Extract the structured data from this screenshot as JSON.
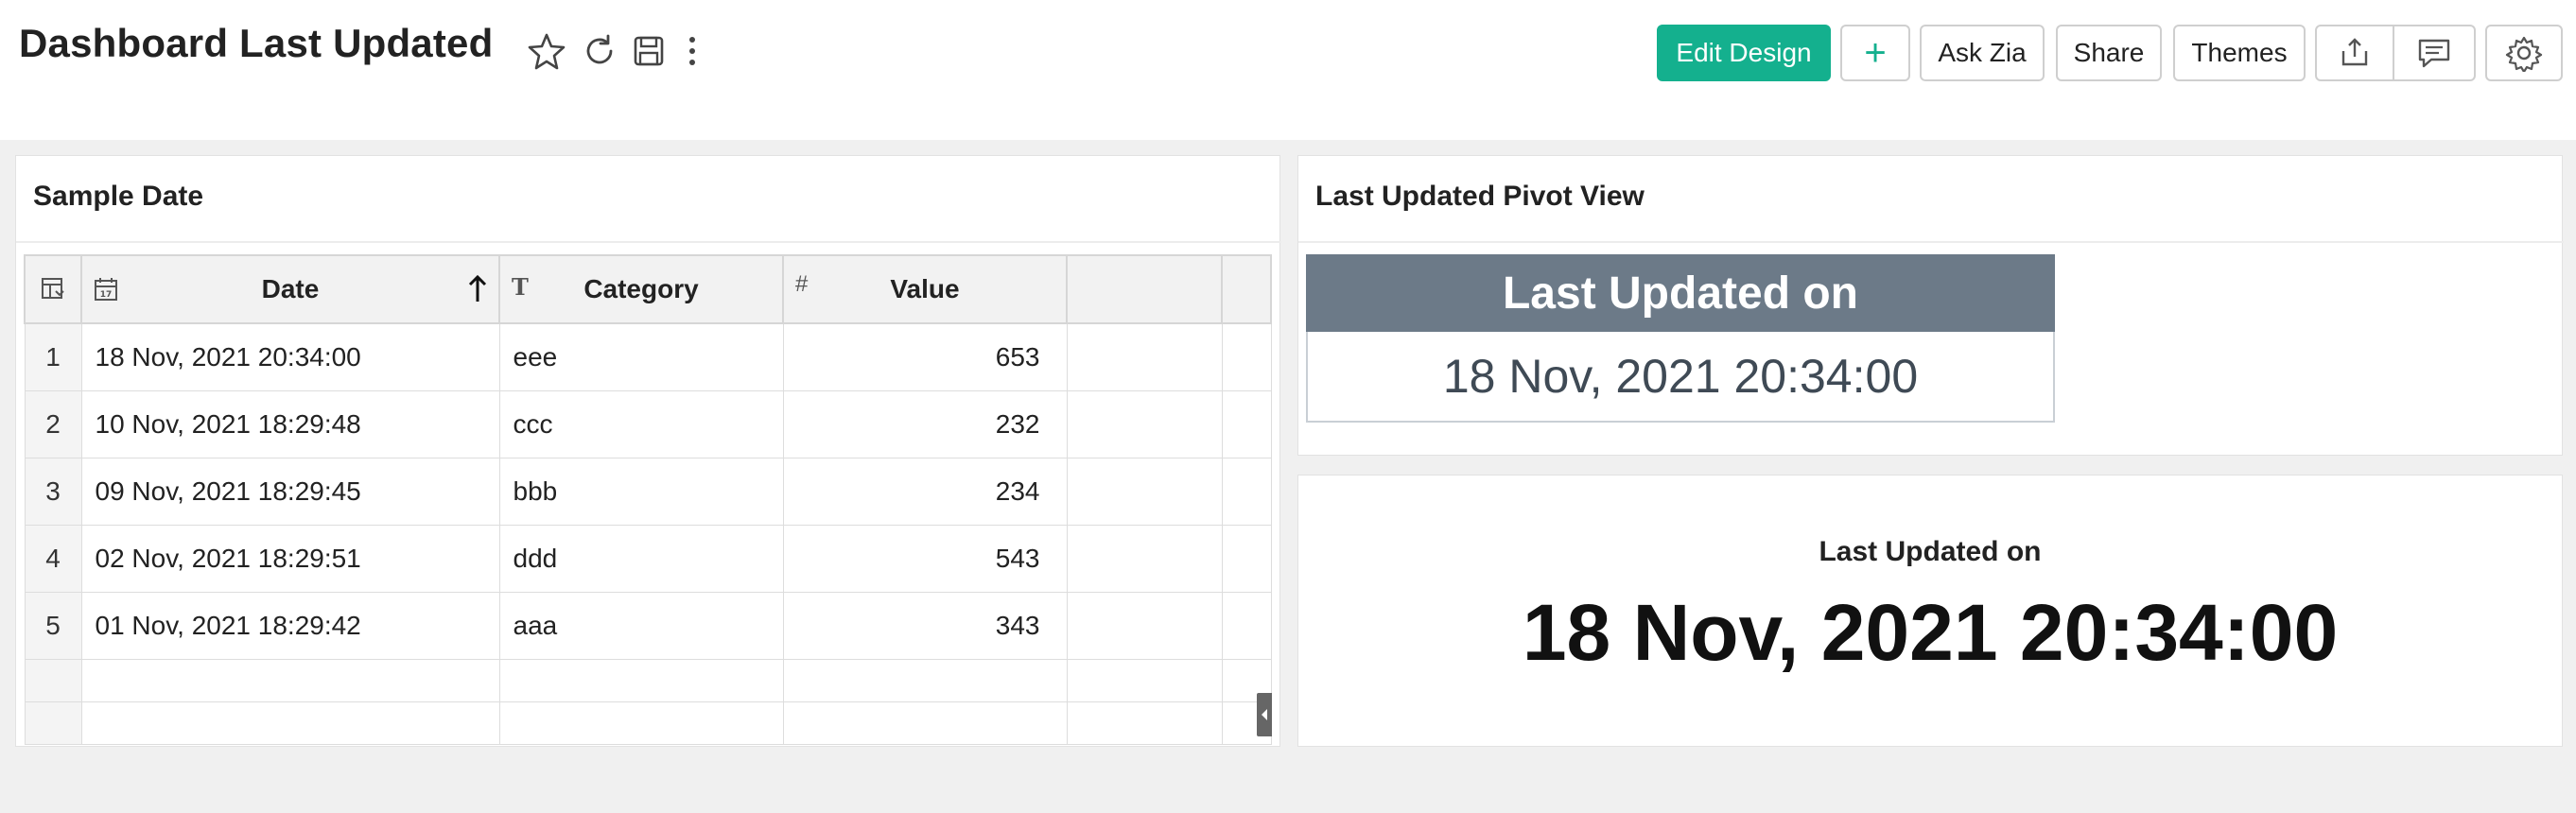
{
  "header": {
    "title": "Dashboard Last Updated",
    "icons": [
      "star-icon",
      "refresh-icon",
      "save-icon",
      "more-vertical-icon"
    ],
    "buttons": {
      "edit_design": "Edit Design",
      "add": "+",
      "ask_zia": "Ask Zia",
      "share": "Share",
      "themes": "Themes"
    },
    "right_icons": [
      "export-icon",
      "comment-icon",
      "settings-icon"
    ]
  },
  "colors": {
    "accent": "#14b08e",
    "pivot_header": "#6c7a88",
    "background": "#f0f0f0"
  },
  "table_panel": {
    "title": "Sample Date",
    "columns": [
      {
        "label": "Date",
        "type_icon": "calendar-icon",
        "sorted": "ascending"
      },
      {
        "label": "Category",
        "type_icon": "text-type-icon"
      },
      {
        "label": "Value",
        "type_icon": "number-type-icon"
      }
    ],
    "rows": [
      {
        "num": "1",
        "date": "18 Nov, 2021 20:34:00",
        "category": "eee",
        "value": "653"
      },
      {
        "num": "2",
        "date": "10 Nov, 2021 18:29:48",
        "category": "ccc",
        "value": "232"
      },
      {
        "num": "3",
        "date": "09 Nov, 2021 18:29:45",
        "category": "bbb",
        "value": "234"
      },
      {
        "num": "4",
        "date": "02 Nov, 2021 18:29:51",
        "category": "ddd",
        "value": "543"
      },
      {
        "num": "5",
        "date": "01 Nov, 2021 18:29:42",
        "category": "aaa",
        "value": "343"
      }
    ]
  },
  "pivot_panel": {
    "title": "Last Updated Pivot View",
    "header": "Last Updated on",
    "value": "18 Nov, 2021 20:34:00"
  },
  "kpi_panel": {
    "label": "Last Updated on",
    "value": "18 Nov, 2021 20:34:00"
  }
}
